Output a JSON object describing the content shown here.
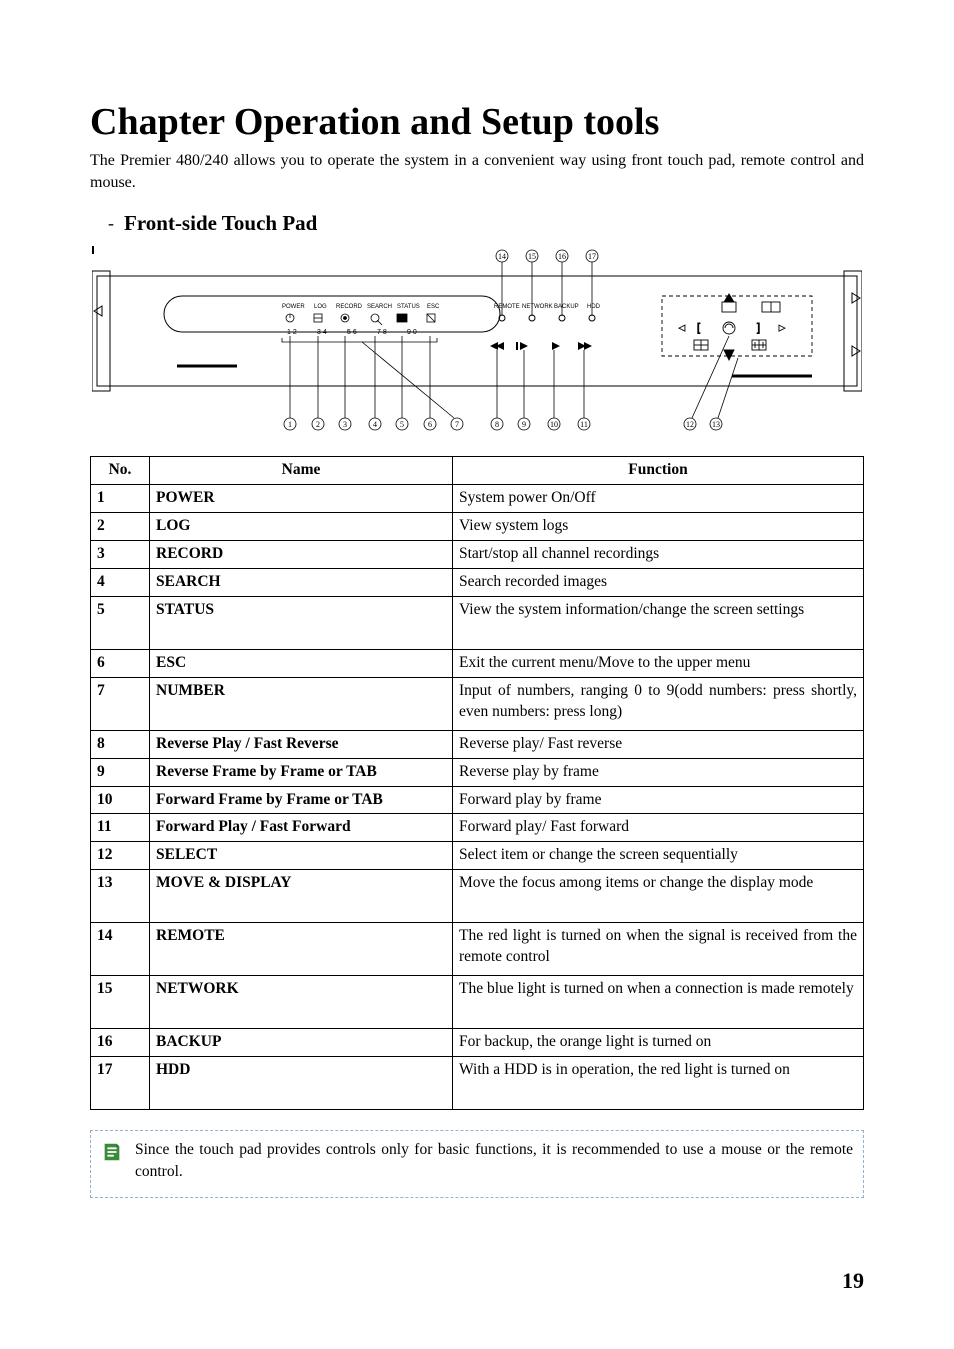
{
  "chapter_title": "Chapter   Operation and Setup tools",
  "intro": "The Premier 480/240 allows you to operate the system in a convenient way using front touch pad, remote control and mouse.",
  "subhead": "Front-side Touch Pad",
  "table": {
    "headers": {
      "no": "No.",
      "name": "Name",
      "func": "Function"
    },
    "rows": [
      {
        "no": "1",
        "name": "POWER",
        "func": "System power On/Off"
      },
      {
        "no": "2",
        "name": "LOG",
        "func": "View system logs"
      },
      {
        "no": "3",
        "name": "RECORD",
        "func": "Start/stop all channel recordings"
      },
      {
        "no": "4",
        "name": "SEARCH",
        "func": "Search recorded images"
      },
      {
        "no": "5",
        "name": "STATUS",
        "func": "View the system information/change the screen settings"
      },
      {
        "no": "6",
        "name": "ESC",
        "func": "Exit the current menu/Move to the upper menu"
      },
      {
        "no": "7",
        "name": "NUMBER",
        "func": "Input of numbers, ranging 0 to 9(odd numbers: press shortly, even numbers: press long)"
      },
      {
        "no": "8",
        "name": "Reverse Play / Fast Reverse",
        "func": "Reverse play/ Fast reverse"
      },
      {
        "no": "9",
        "name": "Reverse Frame by Frame or TAB",
        "func": "Reverse play by frame"
      },
      {
        "no": "10",
        "name": "Forward Frame by Frame or TAB",
        "func": "Forward play by frame"
      },
      {
        "no": "11",
        "name": "Forward Play / Fast Forward",
        "func": "Forward play/ Fast forward"
      },
      {
        "no": "12",
        "name": "SELECT",
        "func": "Select item or change the screen sequentially"
      },
      {
        "no": "13",
        "name": "MOVE & DISPLAY",
        "func": "Move the focus among items or change the display mode"
      },
      {
        "no": "14",
        "name": "REMOTE",
        "func": "The red light is turned on when the signal is received from the remote control"
      },
      {
        "no": "15",
        "name": "NETWORK",
        "func": "The blue light is turned on when a connection is made remotely"
      },
      {
        "no": "16",
        "name": "BACKUP",
        "func": "For backup, the orange light is turned on"
      },
      {
        "no": "17",
        "name": "HDD",
        "func": "With a HDD is in operation, the red light is turned on"
      }
    ]
  },
  "diagram": {
    "top_callouts": [
      "14",
      "15",
      "16",
      "17"
    ],
    "bottom_callouts": [
      "1",
      "2",
      "3",
      "4",
      "5",
      "6",
      "7",
      "8",
      "9",
      "10",
      "11",
      "12",
      "13"
    ],
    "panel_labels": [
      "POWER",
      "LOG",
      "RECORD",
      "SEARCH",
      "STATUS",
      "ESC"
    ],
    "led_labels": [
      "REMOTE",
      "NETWORK",
      "BACKUP",
      "HDD"
    ],
    "number_labels": [
      "1 2",
      "3 4",
      "5 6",
      "7 8",
      "9 0"
    ]
  },
  "note": "Since the touch pad provides controls only for basic functions, it is recommended to use a mouse or the remote control.",
  "page_number": "19"
}
